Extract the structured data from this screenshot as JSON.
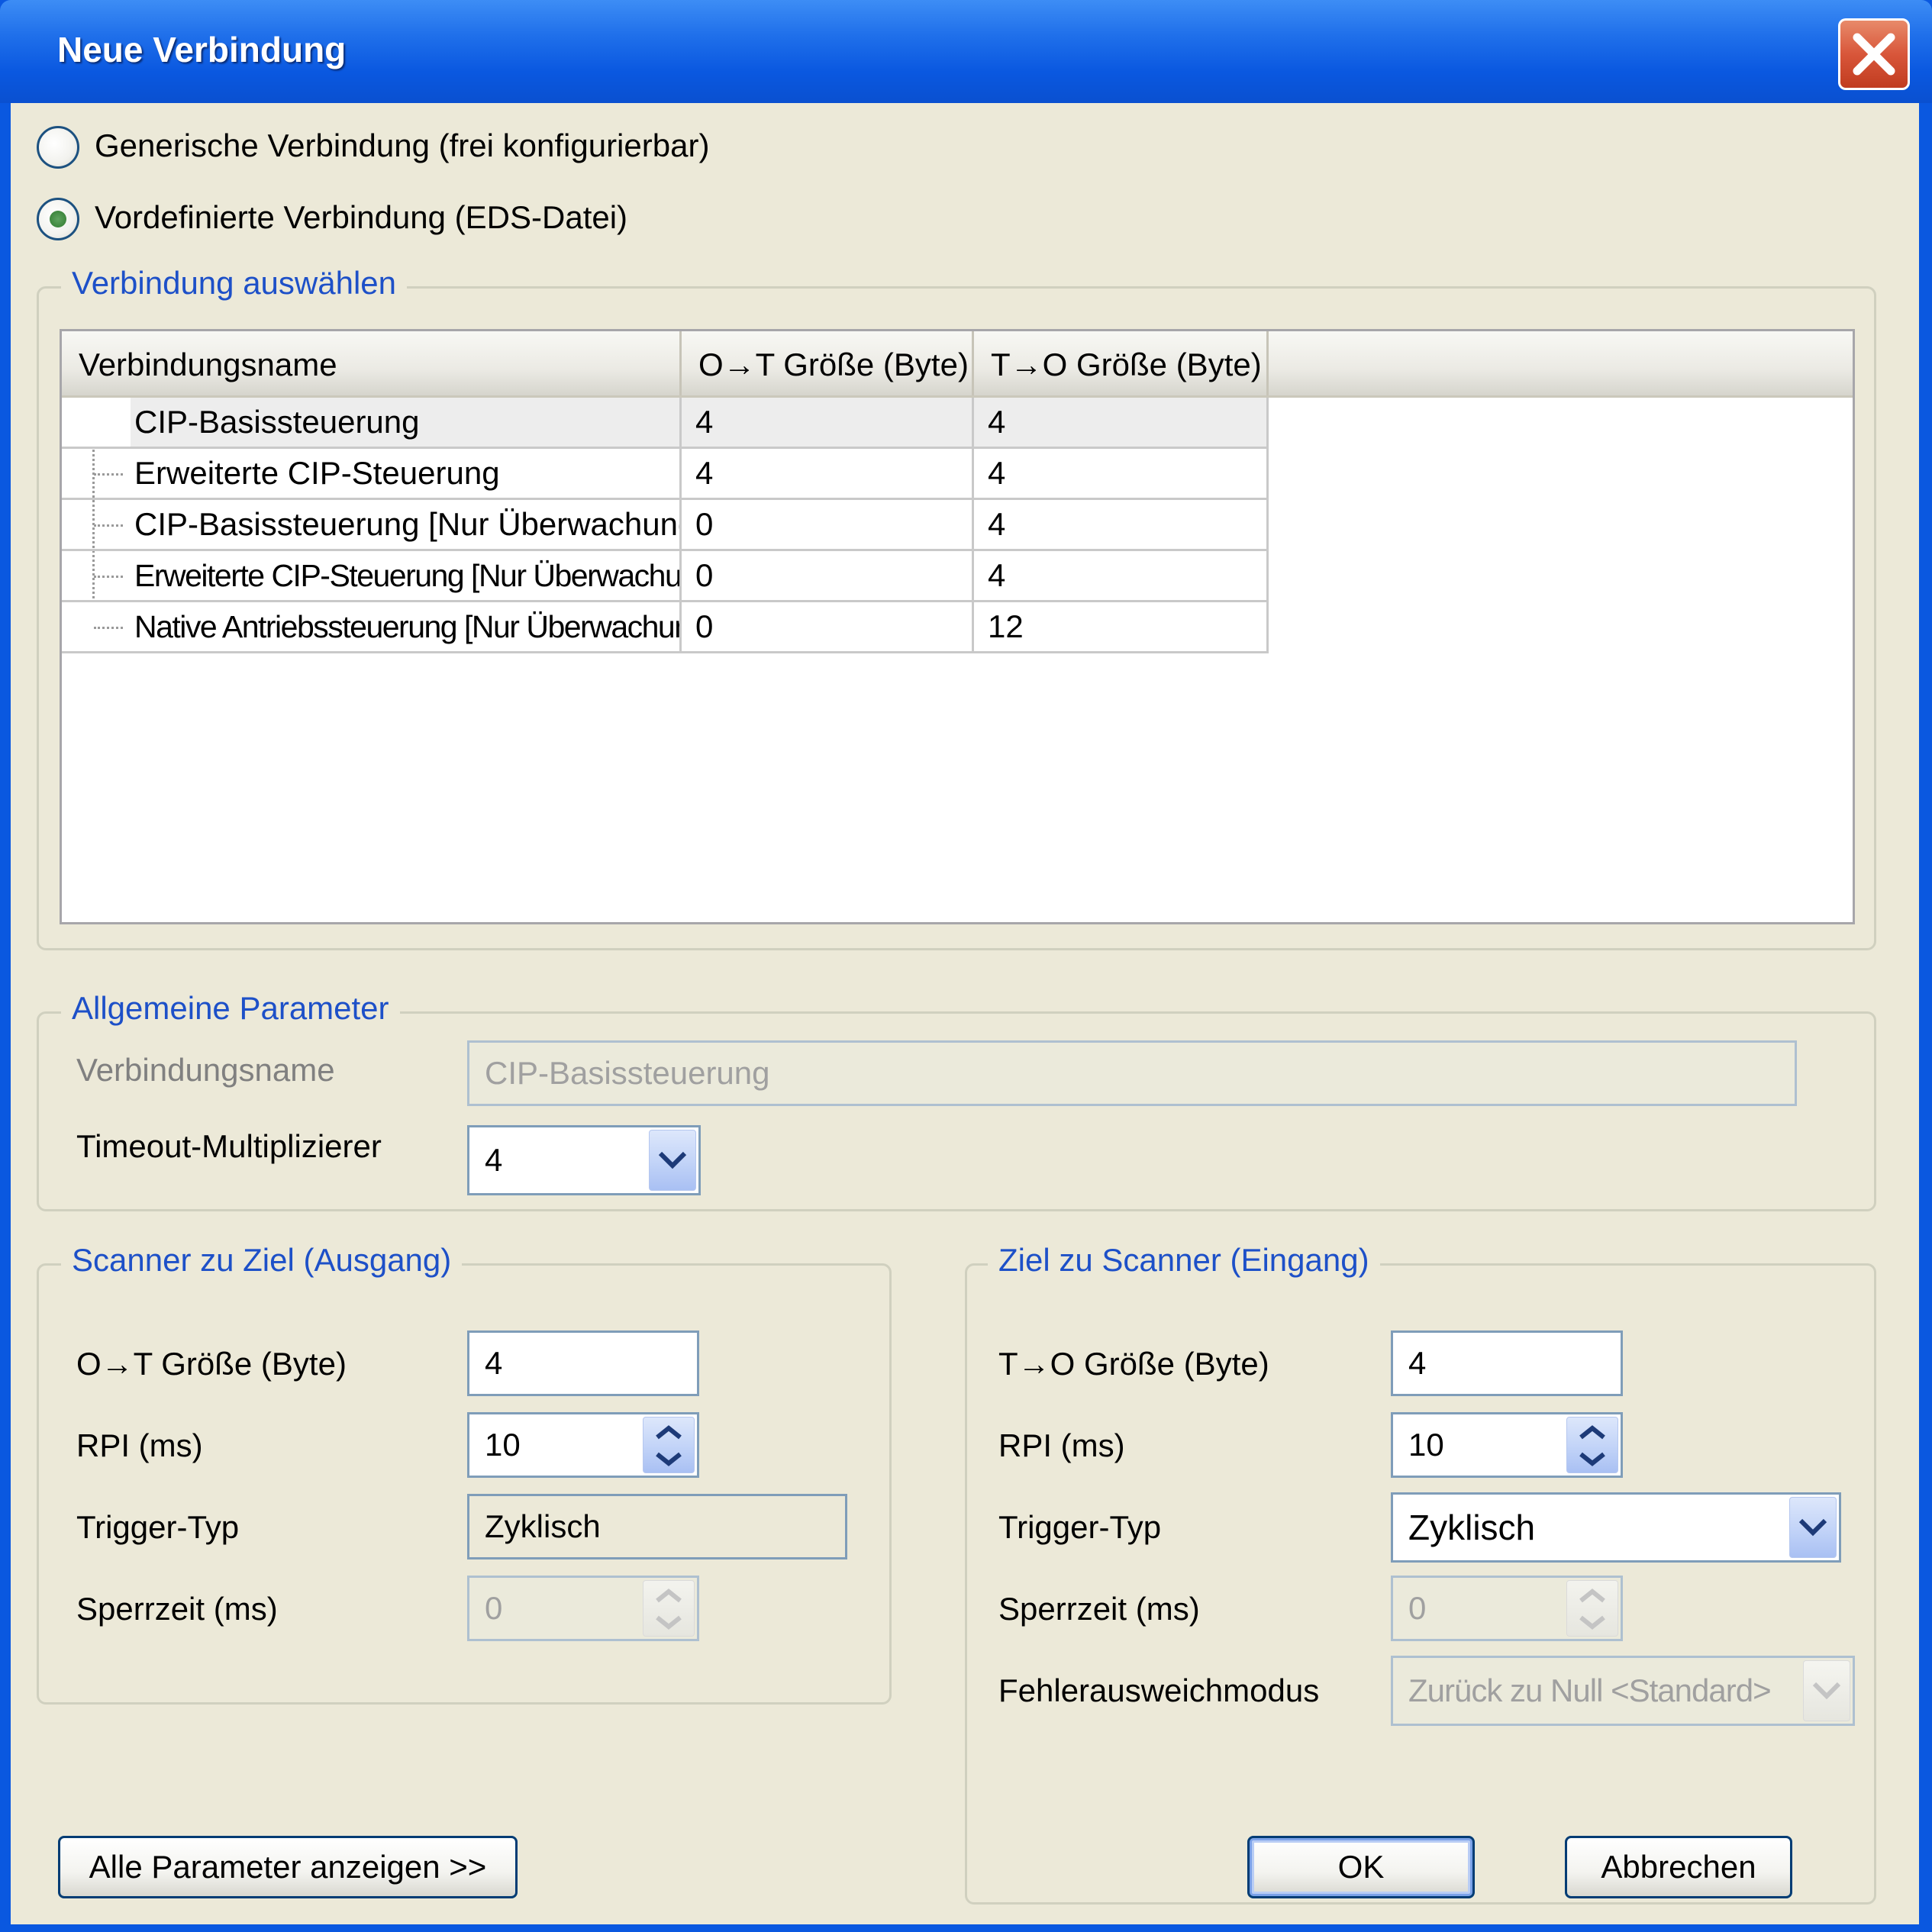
{
  "window": {
    "title": "Neue Verbindung"
  },
  "radios": {
    "generic_label": "Generische Verbindung (frei konfigurierbar)",
    "predefined_label": "Vordefinierte Verbindung (EDS-Datei)",
    "selected": "predefined"
  },
  "select_group": {
    "legend": "Verbindung auswählen",
    "columns": [
      "Verbindungsname",
      "O→T Größe (Byte)",
      "T→O Größe (Byte)"
    ],
    "rows": [
      {
        "name": "CIP-Basissteuerung",
        "ot": "4",
        "to": "4"
      },
      {
        "name": "Erweiterte CIP-Steuerung",
        "ot": "4",
        "to": "4"
      },
      {
        "name": "CIP-Basissteuerung [Nur Überwachung]",
        "ot": "0",
        "to": "4"
      },
      {
        "name": "Erweiterte CIP-Steuerung [Nur Überwachung]",
        "ot": "0",
        "to": "4"
      },
      {
        "name": "Native Antriebssteuerung [Nur Überwachung]",
        "ot": "0",
        "to": "12"
      }
    ],
    "selected_row": 0
  },
  "general": {
    "legend": "Allgemeine Parameter",
    "name_label": "Verbindungsname",
    "name_value": "CIP-Basissteuerung",
    "timeout_label": "Timeout-Multiplizierer",
    "timeout_value": "4"
  },
  "output": {
    "legend": "Scanner zu Ziel (Ausgang)",
    "size_label": "O→T Größe (Byte)",
    "size_value": "4",
    "rpi_label": "RPI (ms)",
    "rpi_value": "10",
    "trigger_label": "Trigger-Typ",
    "trigger_value": "Zyklisch",
    "inhibit_label": "Sperrzeit (ms)",
    "inhibit_value": "0"
  },
  "input": {
    "legend": "Ziel zu Scanner (Eingang)",
    "size_label": "T→O Größe (Byte)",
    "size_value": "4",
    "rpi_label": "RPI (ms)",
    "rpi_value": "10",
    "trigger_label": "Trigger-Typ",
    "trigger_value": "Zyklisch",
    "inhibit_label": "Sperrzeit (ms)",
    "inhibit_value": "0",
    "fault_label": "Fehlerausweichmodus",
    "fault_value": "Zurück zu Null <Standard>"
  },
  "buttons": {
    "show_all": "Alle Parameter anzeigen >>",
    "ok": "OK",
    "cancel": "Abbrechen"
  },
  "colors": {
    "titlebar": "#0a58e0",
    "dialog_bg": "#ece9d8",
    "legend_text": "#1d50c8",
    "close_button": "#d8563a"
  }
}
